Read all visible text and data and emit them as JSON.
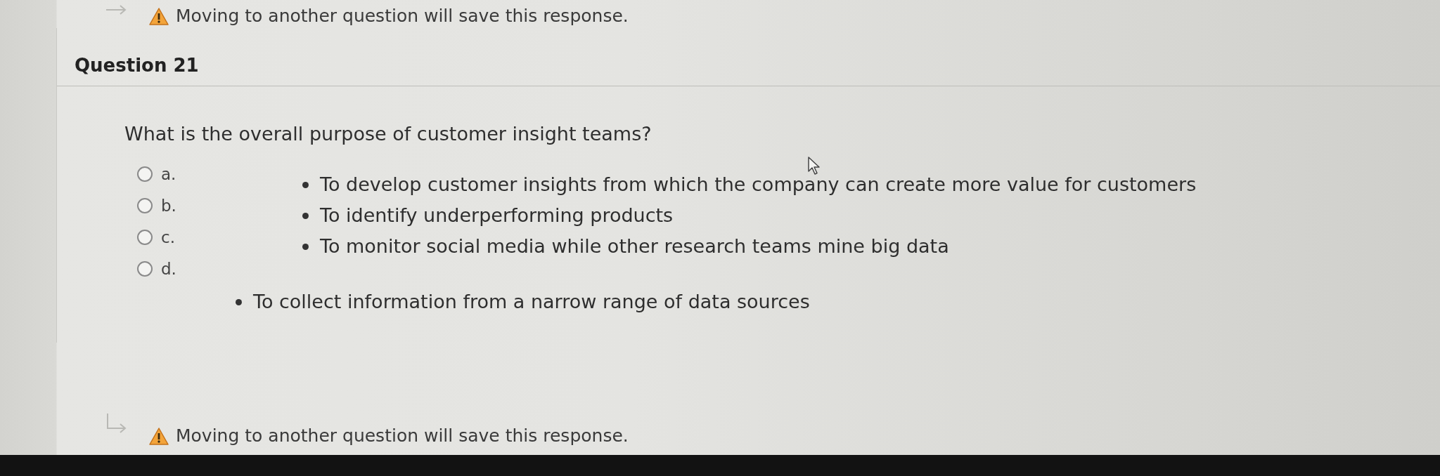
{
  "top_notice": {
    "text": "Moving to another question will save this response."
  },
  "question": {
    "title": "Question 21",
    "prompt": "What is the overall purpose of customer insight teams?",
    "options": [
      {
        "label": "a.",
        "selected": false
      },
      {
        "label": "b.",
        "selected": false
      },
      {
        "label": "c.",
        "selected": false
      },
      {
        "label": "d.",
        "selected": false
      }
    ],
    "answer_lists": [
      {
        "items": [
          "To develop customer insights from which the company can create more value for customers",
          "To identify underperforming products",
          "To monitor social media while other research teams mine big data"
        ]
      },
      {
        "items": [
          "To collect information from a narrow range of data sources"
        ]
      }
    ]
  },
  "bottom_notice": {
    "text": "Moving to another question will save this response."
  }
}
